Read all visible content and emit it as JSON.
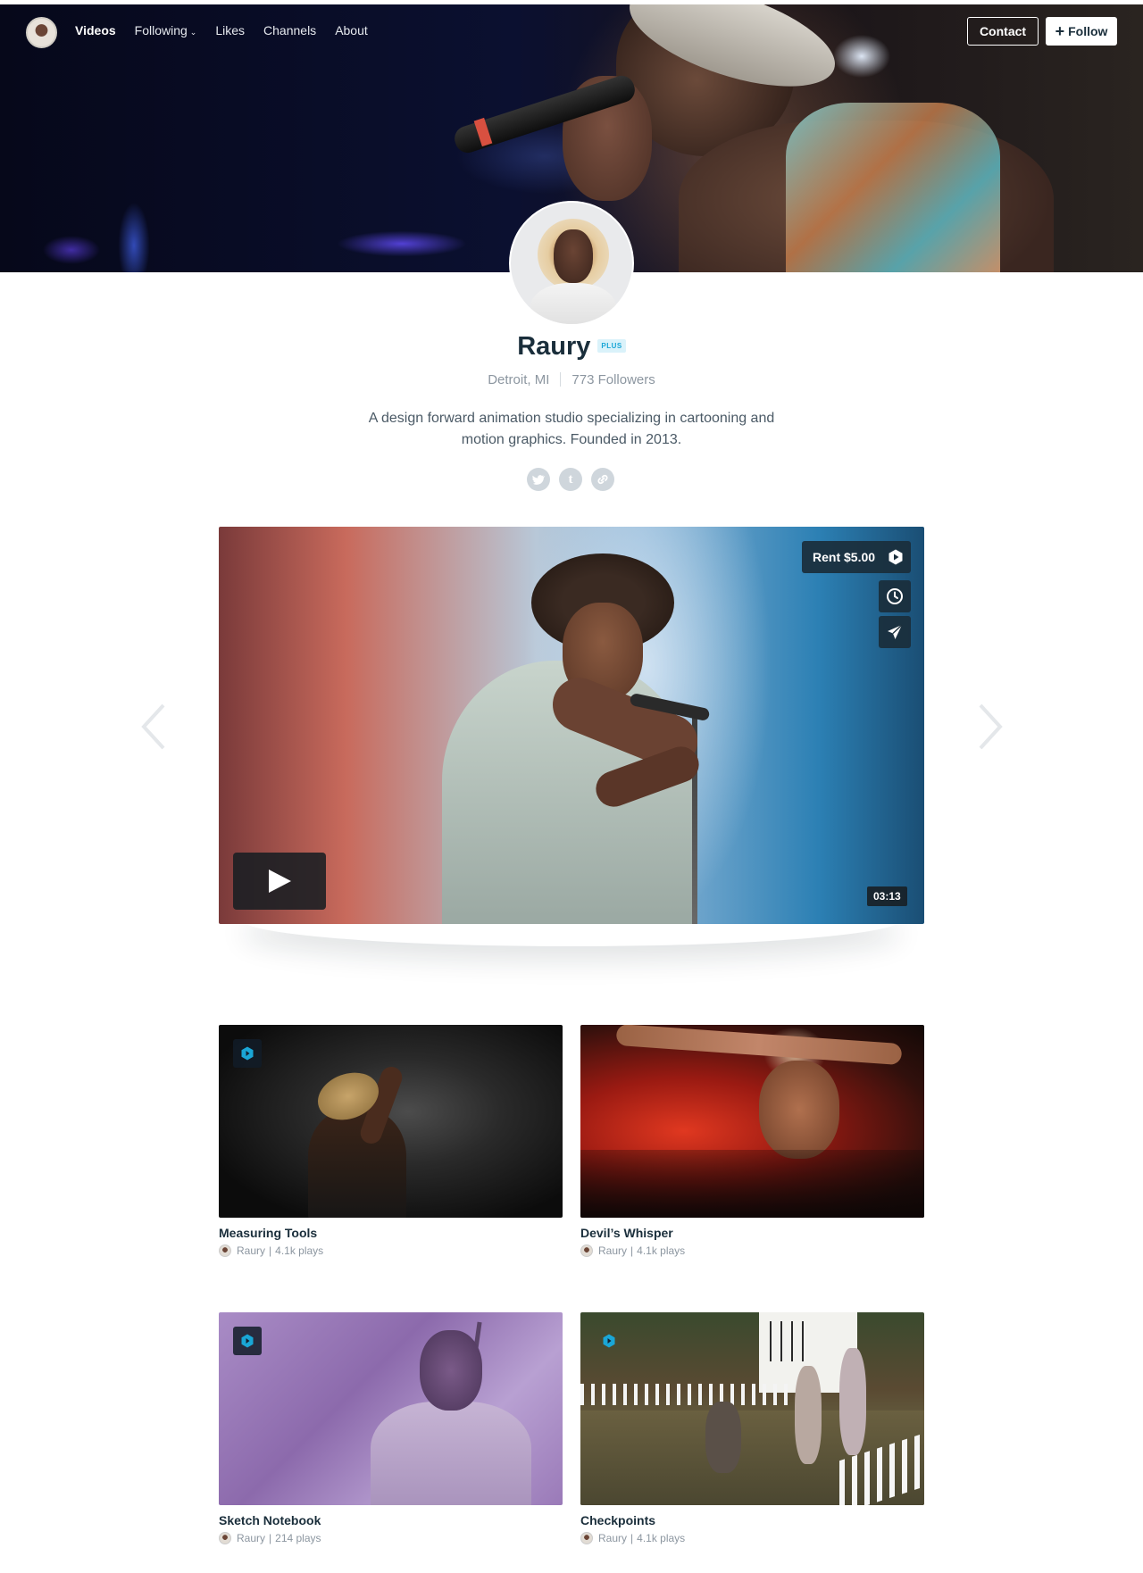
{
  "nav": {
    "items": [
      {
        "label": "Videos",
        "active": true
      },
      {
        "label": "Following",
        "has_dropdown": true
      },
      {
        "label": "Likes"
      },
      {
        "label": "Channels"
      },
      {
        "label": "About"
      }
    ],
    "contact_label": "Contact",
    "follow_label": "Follow"
  },
  "profile": {
    "name": "Raury",
    "badge": "PLUS",
    "location": "Detroit, MI",
    "followers": "773 Followers",
    "bio": "A design forward animation studio specializing in cartooning and motion graphics. Founded in 2013.",
    "socials": [
      {
        "icon": "twitter-icon",
        "glyph": "t"
      },
      {
        "icon": "tumblr-icon",
        "glyph": "t"
      },
      {
        "icon": "link-icon",
        "glyph": "∞"
      }
    ]
  },
  "featured": {
    "rent_label": "Rent $5.00",
    "duration": "03:13",
    "icons": [
      "clock-icon",
      "send-icon",
      "play-icon"
    ]
  },
  "videos": [
    {
      "title": "Measuring Tools",
      "author": "Raury",
      "plays": "4.1k plays"
    },
    {
      "title": "Devil’s Whisper",
      "author": "Raury",
      "plays": "4.1k plays"
    },
    {
      "title": "Sketch Notebook",
      "author": "Raury",
      "plays": "214 plays"
    },
    {
      "title": "Checkpoints",
      "author": "Raury",
      "plays": "4.1k plays"
    }
  ],
  "colors": {
    "text_dark": "#1a2e3b",
    "muted": "#8c96a0",
    "accent": "#1aa6d6",
    "overlay": "#1a2e3b"
  }
}
